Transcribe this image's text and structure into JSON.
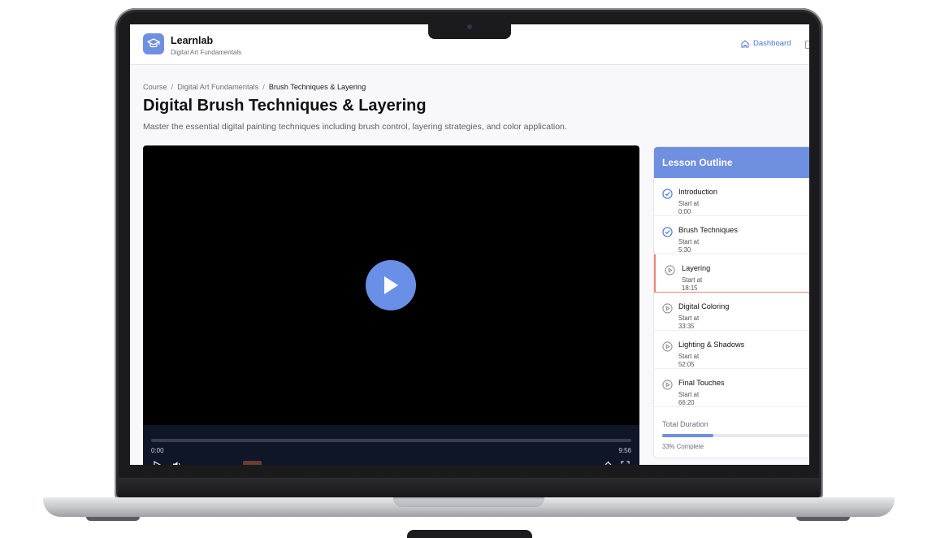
{
  "app": {
    "name": "Learnlab",
    "subtitle": "Digital Art Fundamentals",
    "accent": "#6f8fe0"
  },
  "nav": {
    "dashboard_label": "Dashboard"
  },
  "breadcrumb": [
    "Course",
    "Digital Art Fundamentals",
    "Brush Techniques & Layering"
  ],
  "page": {
    "title": "Digital Brush Techniques & Layering",
    "description": "Master the essential digital painting techniques including brush control, layering strategies, and color application."
  },
  "video": {
    "current_time": "0:00",
    "total_time": "9:56",
    "progress": 0
  },
  "outline": {
    "title": "Lesson Outline",
    "start_label": "Start at",
    "lessons": [
      {
        "name": "Introduction",
        "start": "0:00",
        "status": "completed",
        "icon": "check-circle-icon"
      },
      {
        "name": "Brush Techniques",
        "start": "5:30",
        "status": "completed",
        "icon": "check-circle-icon"
      },
      {
        "name": "Layering",
        "start": "18:15",
        "status": "active",
        "icon": "play-circle-icon"
      },
      {
        "name": "Digital Coloring",
        "start": "33:35",
        "status": "pending",
        "icon": "play-circle-icon"
      },
      {
        "name": "Lighting & Shadows",
        "start": "52:05",
        "status": "pending",
        "icon": "play-circle-icon"
      },
      {
        "name": "Final Touches",
        "start": "66:20",
        "status": "pending",
        "icon": "play-circle-icon"
      }
    ],
    "total_label": "Total Duration",
    "complete_percent": 33,
    "complete_text": "33% Complete"
  }
}
